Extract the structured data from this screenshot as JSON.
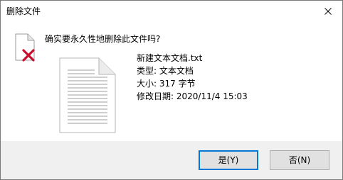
{
  "dialog": {
    "title": "删除文件",
    "question": "确实要永久性地删除此文件吗?"
  },
  "file": {
    "name": "新建文本文档.txt",
    "type": "类型: 文本文档",
    "size": "大小: 317 字节",
    "modified": "修改日期: 2020/11/4 15:03"
  },
  "buttons": {
    "yes_label": "是(Y)",
    "no_label": "否(N)"
  },
  "icons": {
    "close": "close-icon",
    "delete": "delete-file-icon",
    "document": "text-document-icon"
  },
  "colors": {
    "default_button_border": "#0078d7",
    "delete_mark": "#c8102e",
    "footer_background": "#f0f0f0"
  }
}
